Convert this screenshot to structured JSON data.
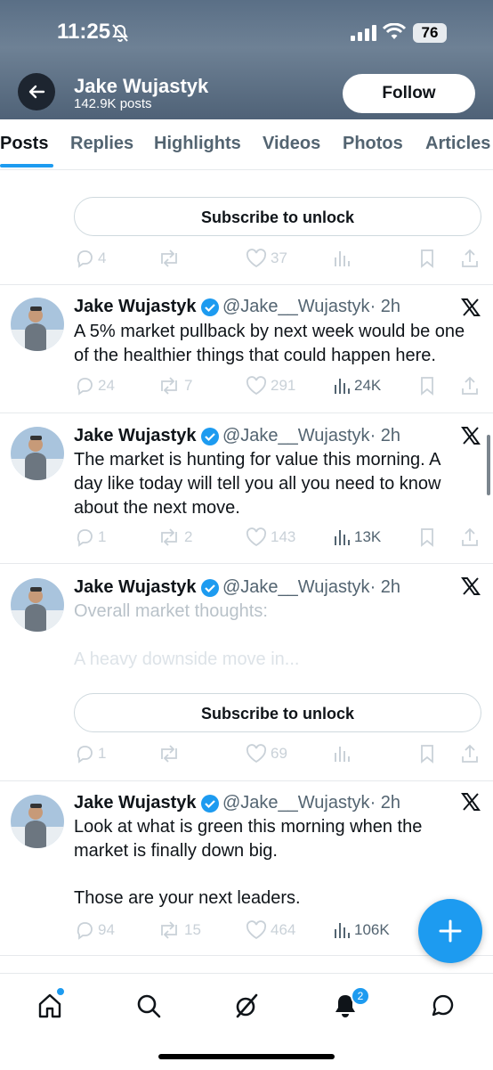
{
  "status_bar": {
    "time": "11:25",
    "battery": "76"
  },
  "header": {
    "name": "Jake Wujastyk",
    "posts": "142.9K posts",
    "follow_label": "Follow"
  },
  "tabs": [
    "Posts",
    "Replies",
    "Highlights",
    "Videos",
    "Photos",
    "Articles"
  ],
  "subscribe_label": "Subscribe to unlock",
  "post0": {
    "replies": "4",
    "reposts": "",
    "likes": "37"
  },
  "post1": {
    "name": "Jake Wujastyk",
    "handle": "@Jake__Wujastyk",
    "time": "· 2h",
    "lines": [
      "A 5% market pullback by next week would be one",
      "of the healthier things that could happen here."
    ],
    "replies": "24",
    "reposts": "7",
    "likes": "291",
    "views": "24K"
  },
  "post2": {
    "name": "Jake Wujastyk",
    "handle": "@Jake__Wujastyk",
    "time": "· 2h",
    "lines": [
      "The market is hunting for value this morning. A",
      "day like today will tell you all you need to know",
      "about the next move."
    ],
    "replies": "1",
    "reposts": "2",
    "likes": "143",
    "views": "13K"
  },
  "post3": {
    "name": "Jake Wujastyk",
    "handle": "@Jake__Wujastyk",
    "time": "· 2h",
    "line1": "Overall market thoughts:",
    "line2": "A heavy downside move in...",
    "replies": "1",
    "reposts": "",
    "likes": "69"
  },
  "post4": {
    "name": "Jake Wujastyk",
    "handle": "@Jake__Wujastyk",
    "time": "· 2h",
    "lines": [
      "Look at what is green this morning when the",
      "market is finally down big."
    ],
    "line3": "Those are your next leaders.",
    "replies": "94",
    "reposts": "15",
    "likes": "464",
    "views": "106K"
  },
  "nav": {
    "notifications_badge": "2"
  },
  "colors": {
    "accent": "#1d9bf0",
    "text": "#0f1419",
    "muted": "#536471"
  }
}
